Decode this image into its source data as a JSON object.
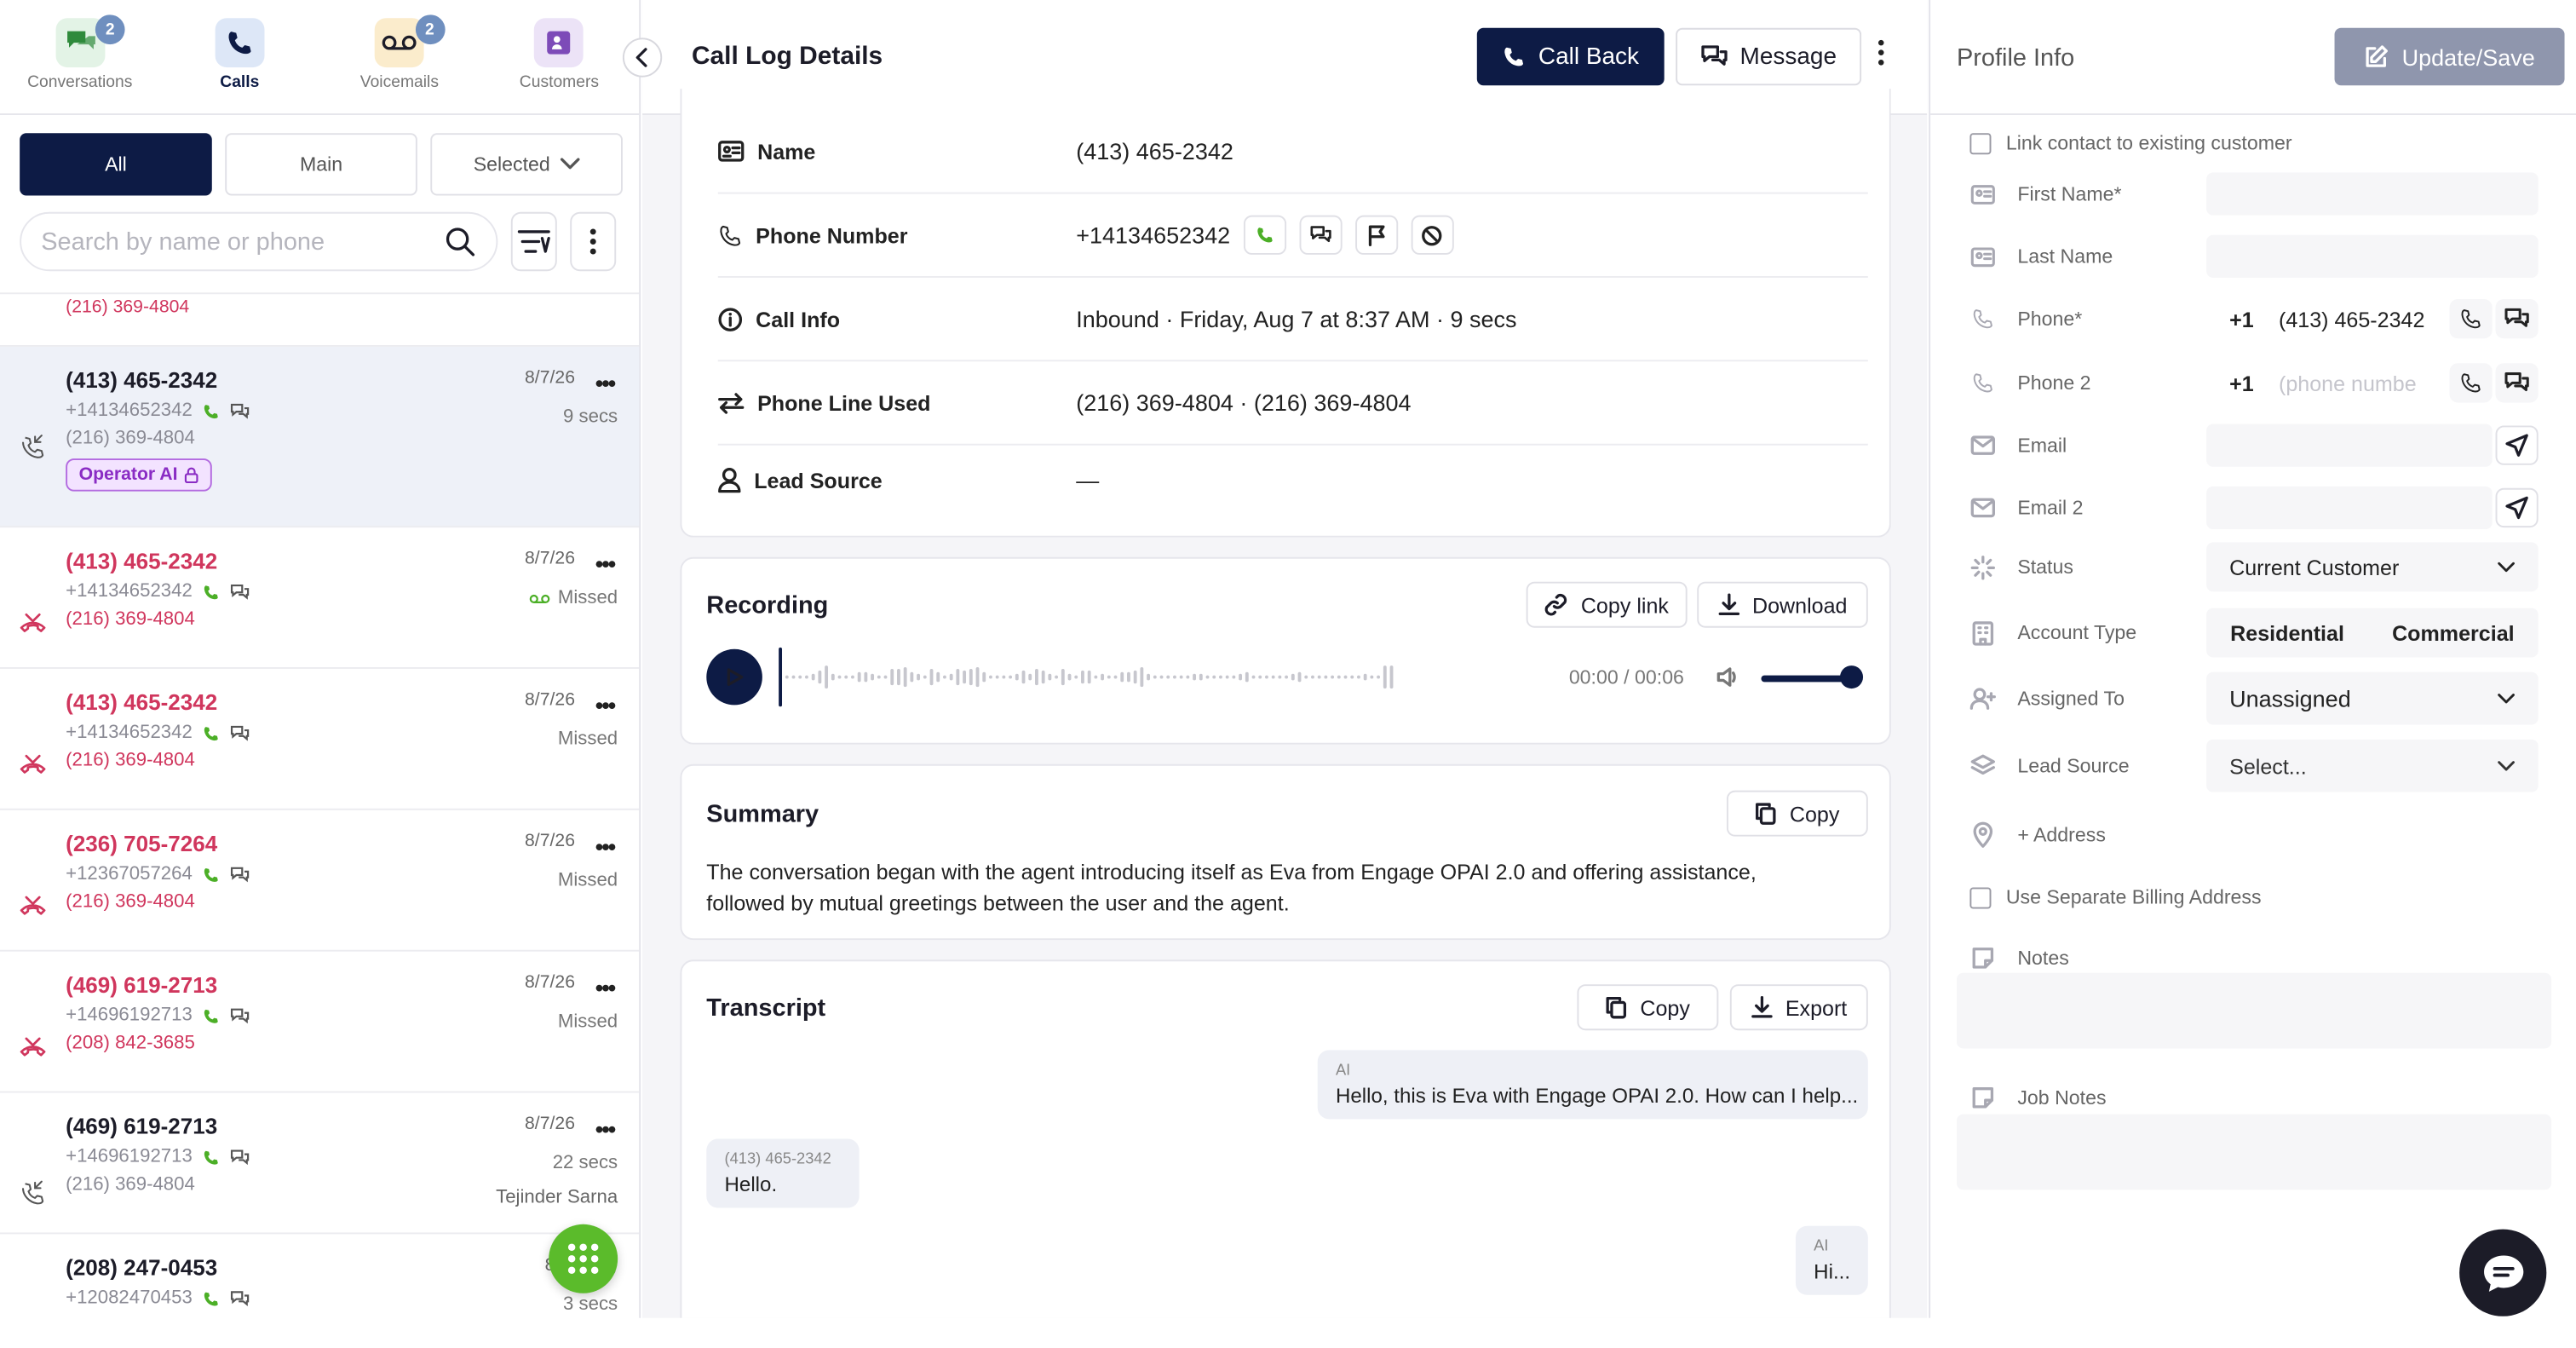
{
  "nav": {
    "tabs": [
      {
        "label": "Conversations",
        "badge": "2"
      },
      {
        "label": "Calls",
        "badge": ""
      },
      {
        "label": "Voicemails",
        "badge": "2"
      },
      {
        "label": "Customers",
        "badge": ""
      }
    ]
  },
  "filters": {
    "all": "All",
    "main": "Main",
    "selected": "Selected"
  },
  "search": {
    "placeholder": "Search by name or phone"
  },
  "list": {
    "top_stub": "(216) 369-4804",
    "items": [
      {
        "title": "(413) 465-2342",
        "from": "+14134652342",
        "line": "(216) 369-4804",
        "date": "8/7/26",
        "status": "9 secs",
        "agent": "",
        "pill": "Operator AI",
        "missed": false
      },
      {
        "title": "(413) 465-2342",
        "from": "+14134652342",
        "line": "(216) 369-4804",
        "date": "8/7/26",
        "status": "Missed",
        "agent": "",
        "pill": "",
        "missed": true
      },
      {
        "title": "(413) 465-2342",
        "from": "+14134652342",
        "line": "(216) 369-4804",
        "date": "8/7/26",
        "status": "Missed",
        "agent": "",
        "pill": "",
        "missed": true
      },
      {
        "title": "(236) 705-7264",
        "from": "+12367057264",
        "line": "(216) 369-4804",
        "date": "8/7/26",
        "status": "Missed",
        "agent": "",
        "pill": "",
        "missed": true
      },
      {
        "title": "(469) 619-2713",
        "from": "+14696192713",
        "line": "(208) 842-3685",
        "date": "8/7/26",
        "status": "Missed",
        "agent": "",
        "pill": "",
        "missed": true
      },
      {
        "title": "(469) 619-2713",
        "from": "+14696192713",
        "line": "(216) 369-4804",
        "date": "8/7/26",
        "status": "22 secs",
        "agent": "Tejinder Sarna",
        "pill": "",
        "missed": false
      },
      {
        "title": "(208) 247-0453",
        "from": "+12082470453",
        "line": "",
        "date": "8/7/",
        "status": "3 secs",
        "agent": "",
        "pill": "",
        "missed": false
      }
    ]
  },
  "detail": {
    "title": "Call Log Details",
    "call_back": "Call Back",
    "message": "Message",
    "rows": [
      {
        "label": "Name",
        "value": "(413) 465-2342"
      },
      {
        "label": "Phone Number",
        "value": "+14134652342"
      },
      {
        "label": "Call Info",
        "value": "Inbound · Friday, Aug 7 at 8:37 AM · 9 secs"
      },
      {
        "label": "Phone Line Used",
        "value": "(216) 369-4804 · (216) 369-4804"
      },
      {
        "label": "Lead Source",
        "value": "—"
      }
    ],
    "recording": {
      "title": "Recording",
      "copy_link": "Copy link",
      "download": "Download",
      "time": "00:00 / 00:06",
      "volume": 1.0
    },
    "summary": {
      "title": "Summary",
      "copy": "Copy",
      "text": "The conversation began with the agent introducing itself as Eva from Engage OPAI 2.0 and offering assistance, followed by mutual greetings between the user and the agent."
    },
    "transcript": {
      "title": "Transcript",
      "copy": "Copy",
      "export": "Export",
      "messages": [
        {
          "who": "AI",
          "text": "Hello, this is Eva with Engage OPAI 2.0. How can I help..."
        },
        {
          "who": "(413) 465-2342",
          "text": "Hello."
        },
        {
          "who": "AI",
          "text": "Hi..."
        }
      ]
    }
  },
  "profile": {
    "title": "Profile Info",
    "update": "Update/Save",
    "link_contact": "Link contact to existing customer",
    "first_name": "First Name*",
    "last_name": "Last Name",
    "phone": {
      "label": "Phone*",
      "code": "+1",
      "value": "(413) 465-2342"
    },
    "phone2": {
      "label": "Phone 2",
      "code": "+1",
      "placeholder": "(phone numbe"
    },
    "email": "Email",
    "email2": "Email 2",
    "status": {
      "label": "Status",
      "value": "Current Customer"
    },
    "account_type": {
      "label": "Account Type",
      "options": [
        "Residential",
        "Commercial"
      ]
    },
    "assigned_to": {
      "label": "Assigned To",
      "value": "Unassigned"
    },
    "lead_source": {
      "label": "Lead Source",
      "value": "Select..."
    },
    "address": "+ Address",
    "billing": "Use Separate Billing Address",
    "notes": "Notes",
    "job_notes": "Job Notes"
  },
  "colors": {
    "navy": "#0d1b45",
    "missed": "#d0365d",
    "green": "#5bbb2b",
    "pill": "#8a2cc4"
  }
}
